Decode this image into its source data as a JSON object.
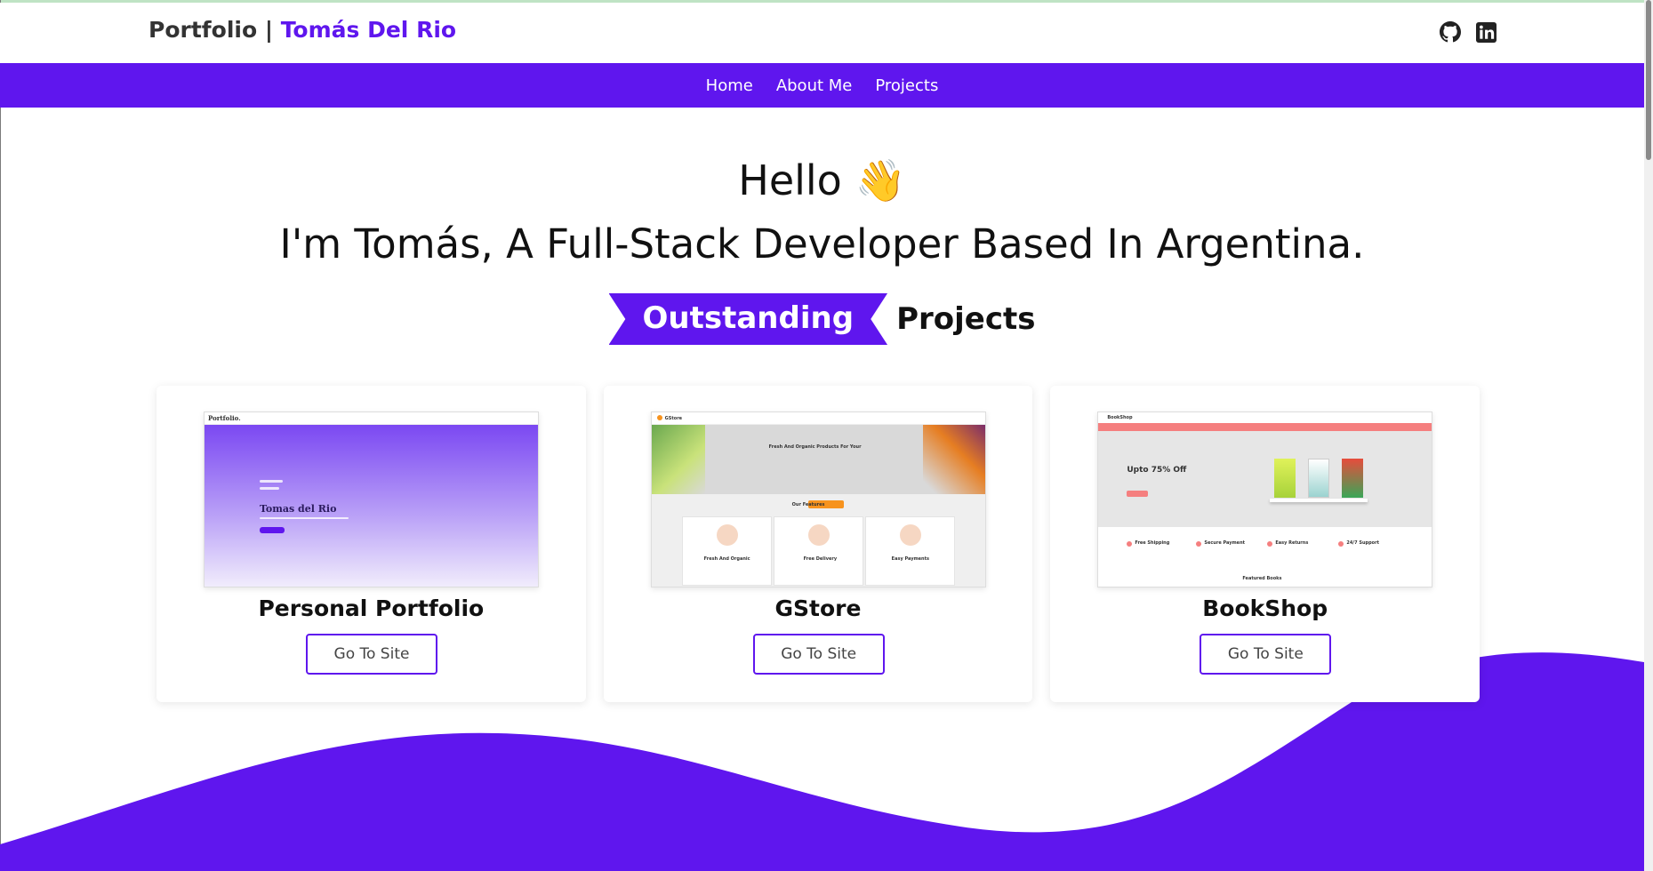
{
  "header": {
    "brand_prefix": "Portfolio | ",
    "brand_name": "Tomás Del Rio"
  },
  "nav": {
    "items": [
      {
        "label": "Home"
      },
      {
        "label": "About Me"
      },
      {
        "label": "Projects"
      }
    ]
  },
  "hero": {
    "greeting": "Hello",
    "wave_emoji": "👋",
    "intro": "I'm Tomás, A Full-Stack Developer Based In Argentina."
  },
  "projects_section": {
    "highlight": "Outstanding",
    "rest": "Projects"
  },
  "projects": [
    {
      "title": "Personal Portfolio",
      "button": "Go To Site",
      "thumb": {
        "logo": "Portfolio.",
        "name": "Tomas del Rio"
      }
    },
    {
      "title": "GStore",
      "button": "Go To Site",
      "thumb": {
        "logo": "GStore",
        "headline": "Fresh And Organic Products For Your",
        "section": "Our Features",
        "features": [
          "Fresh And Organic",
          "Free Delivery",
          "Easy Payments"
        ]
      }
    },
    {
      "title": "BookShop",
      "button": "Go To Site",
      "thumb": {
        "logo": "BookShop",
        "headline": "Upto 75% Off",
        "perks": [
          "Free Shipping",
          "Secure Payment",
          "Easy Returns",
          "24/7 Support"
        ],
        "section": "Featured Books"
      }
    }
  ],
  "icons": [
    "github-icon",
    "linkedin-icon"
  ],
  "colors": {
    "accent": "#5f16ee",
    "text": "#111111",
    "brand_text": "#333333"
  }
}
